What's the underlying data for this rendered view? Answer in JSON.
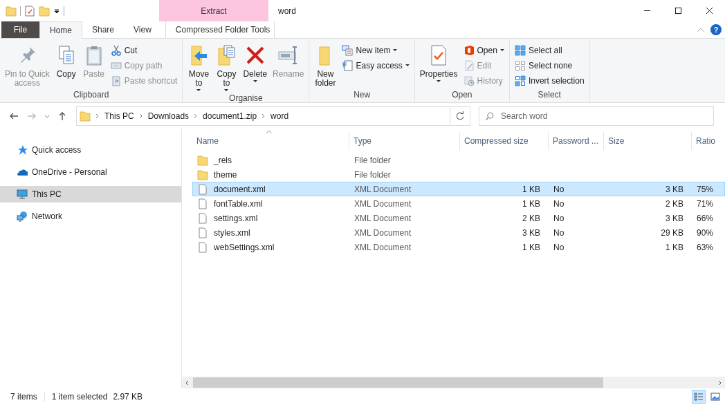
{
  "window": {
    "title": "word",
    "contextual_tab": "Extract"
  },
  "tabs": [
    {
      "label": "File",
      "kind": "file",
      "selected": false
    },
    {
      "label": "Home",
      "kind": "tab",
      "selected": true
    },
    {
      "label": "Share",
      "kind": "tab",
      "selected": false
    },
    {
      "label": "View",
      "kind": "tab",
      "selected": false
    },
    {
      "label": "Compressed Folder Tools",
      "kind": "context",
      "selected": false
    }
  ],
  "help_button": "?",
  "ribbon": [
    {
      "label": "Clipboard",
      "items": [
        {
          "label": "Pin to Quick\naccess",
          "kind": "large",
          "disabled": true,
          "dropdown": false
        },
        {
          "label": "Copy",
          "kind": "large",
          "disabled": false,
          "dropdown": false
        },
        {
          "label": "Paste",
          "kind": "large",
          "disabled": true,
          "dropdown": false
        },
        {
          "label": "Cut",
          "kind": "small",
          "disabled": false,
          "dropdown": false
        },
        {
          "label": "Copy path",
          "kind": "small",
          "disabled": true,
          "dropdown": false
        },
        {
          "label": "Paste shortcut",
          "kind": "small",
          "disabled": true,
          "dropdown": false
        }
      ]
    },
    {
      "label": "Organise",
      "items": [
        {
          "label": "Move\nto",
          "kind": "large",
          "disabled": false,
          "dropdown": true
        },
        {
          "label": "Copy\nto",
          "kind": "large",
          "disabled": false,
          "dropdown": true
        },
        {
          "label": "Delete",
          "kind": "large",
          "disabled": false,
          "dropdown": true
        },
        {
          "label": "Rename",
          "kind": "large",
          "disabled": true,
          "dropdown": false
        }
      ]
    },
    {
      "label": "New",
      "items": [
        {
          "label": "New\nfolder",
          "kind": "large",
          "disabled": false,
          "dropdown": false
        },
        {
          "label": "New item",
          "kind": "small",
          "disabled": false,
          "dropdown": true
        },
        {
          "label": "Easy access",
          "kind": "small",
          "disabled": false,
          "dropdown": true
        }
      ]
    },
    {
      "label": "Open",
      "items": [
        {
          "label": "Properties",
          "kind": "large",
          "disabled": false,
          "dropdown": true
        },
        {
          "label": "Open",
          "kind": "small",
          "disabled": false,
          "dropdown": true
        },
        {
          "label": "Edit",
          "kind": "small",
          "disabled": true,
          "dropdown": false
        },
        {
          "label": "History",
          "kind": "small",
          "disabled": true,
          "dropdown": false
        }
      ]
    },
    {
      "label": "Select",
      "items": [
        {
          "label": "Select all",
          "kind": "small",
          "disabled": false,
          "dropdown": false
        },
        {
          "label": "Select none",
          "kind": "small",
          "disabled": false,
          "dropdown": false
        },
        {
          "label": "Invert selection",
          "kind": "small",
          "disabled": false,
          "dropdown": false
        }
      ]
    }
  ],
  "address": {
    "crumbs": [
      "This PC",
      "Downloads",
      "document1.zip",
      "word"
    ]
  },
  "search": {
    "placeholder": "Search word"
  },
  "sidebar": {
    "items": [
      {
        "label": "Quick access",
        "selected": false
      },
      {
        "label": "OneDrive - Personal",
        "selected": false
      },
      {
        "label": "This PC",
        "selected": true
      },
      {
        "label": "Network",
        "selected": false
      }
    ]
  },
  "table": {
    "columns": [
      "Name",
      "Type",
      "Compressed size",
      "Password ...",
      "Size",
      "Ratio"
    ],
    "rows": [
      {
        "kind": "folder",
        "selected": false,
        "cells": [
          "_rels",
          "File folder",
          "",
          "",
          "",
          ""
        ]
      },
      {
        "kind": "folder",
        "selected": false,
        "cells": [
          "theme",
          "File folder",
          "",
          "",
          "",
          ""
        ]
      },
      {
        "kind": "file",
        "selected": true,
        "cells": [
          "document.xml",
          "XML Document",
          "1 KB",
          "No",
          "3 KB",
          "75%"
        ]
      },
      {
        "kind": "file",
        "selected": false,
        "cells": [
          "fontTable.xml",
          "XML Document",
          "1 KB",
          "No",
          "2 KB",
          "71%"
        ]
      },
      {
        "kind": "file",
        "selected": false,
        "cells": [
          "settings.xml",
          "XML Document",
          "2 KB",
          "No",
          "3 KB",
          "66%"
        ]
      },
      {
        "kind": "file",
        "selected": false,
        "cells": [
          "styles.xml",
          "XML Document",
          "3 KB",
          "No",
          "29 KB",
          "90%"
        ]
      },
      {
        "kind": "file",
        "selected": false,
        "cells": [
          "webSettings.xml",
          "XML Document",
          "1 KB",
          "No",
          "1 KB",
          "63%"
        ]
      }
    ]
  },
  "status_bar": {
    "count": "7 items",
    "selection": "1 item selected",
    "selection_size": "2.97 KB",
    "views": [
      {
        "kind": "details",
        "selected": true
      },
      {
        "kind": "large-icons",
        "selected": false
      }
    ]
  }
}
